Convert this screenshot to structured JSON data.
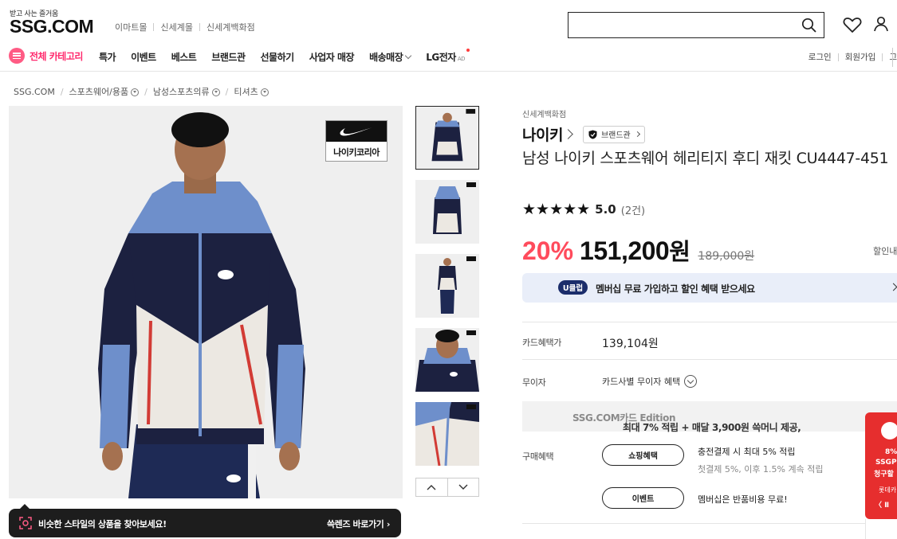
{
  "header": {
    "slogan": "받고 사는 즐거움",
    "logo": "SSG.COM",
    "malls": [
      "이마트몰",
      "신세계몰",
      "신세계백화점"
    ],
    "search_value": ""
  },
  "nav": {
    "all_categories": "전체 카테고리",
    "items": [
      "특가",
      "이벤트",
      "베스트",
      "브랜드관",
      "선물하기",
      "사업자 매장",
      "배송매장",
      "LG전자"
    ],
    "ad_tag": "AD",
    "right": [
      "로그인",
      "회원가입",
      "고"
    ]
  },
  "breadcrumb": [
    "SSG.COM",
    "스포츠웨어/용품",
    "남성스포츠의류",
    "티셔츠"
  ],
  "product": {
    "brand_badge": "나이키코리아",
    "store": "신세계백화점",
    "brand": "나이키",
    "brand_hall": "브랜드관",
    "title": "남성 나이키 스포츠웨어 헤리티지 후디 재킷 CU4447-451",
    "stars": "★★★★★",
    "rating": "5.0",
    "review_count": "(2건)",
    "discount": "20%",
    "price": "151,200",
    "price_unit": "원",
    "original_price": "189,000원",
    "discount_info": "할인내"
  },
  "membership": {
    "badge": "U클럽",
    "text": "멤버십 무료 가입하고 할인 혜택 받으세요"
  },
  "details": {
    "card_label": "카드혜택가",
    "card_value": "139,104원",
    "installment_label": "무이자",
    "installment_value": "카드사별 무이자 혜택",
    "point_text_main": "최대 7% 적립 + 매달 3,900원 쓱머니 제공, ",
    "point_text_sub": "SSG.COM카드 Edition",
    "benefit_label": "구매혜택",
    "shopping_btn": "쇼핑혜택",
    "shopping_main": "충전결제 시 최대 5% 적립",
    "shopping_sub": "첫결제 5%, 이후 1.5% 계속 적립",
    "event_btn": "이벤트",
    "event_text": "멤버십은 반품비용 무료!"
  },
  "banner": {
    "text": "비슷한 스타일의 상품을 찾아보세요!",
    "link": "쓱렌즈 바로가기"
  },
  "side_ad": {
    "line1": "8%",
    "line2": "SSGP",
    "line3": "청구할",
    "line4": "롯데카",
    "line5": "〈 Ⅱ"
  },
  "colors": {
    "accent_pink": "#ff2a6d",
    "discount_red": "#ff4b5c",
    "uclub_navy": "#1b2d6b",
    "member_bar": "#e9eef9",
    "side_ad_red": "#e62e2e"
  }
}
